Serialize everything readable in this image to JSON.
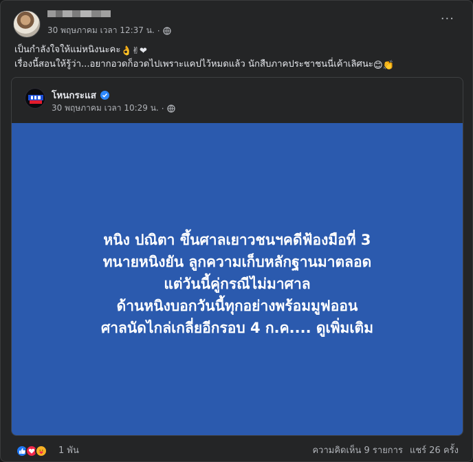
{
  "post": {
    "timestamp": "30 พฤษภาคม เวลา 12:37 น.",
    "separator": "·",
    "caption_line1": "เป็นกำลังใจให้แม่หนิงนะคะ",
    "caption_line1_emojis": "👌✌❤",
    "caption_line2": "เรื่องนี้สอนให้รู้ว่า...อยากอวดก็อวดไปเพราะแคปไว้หมดแล้ว นักสืบภาคประชาชนนี่เค้าเลิศนะ",
    "caption_line2_emojis": "😊👏",
    "more_label": "···"
  },
  "shared": {
    "page_name": "โหนกระแส",
    "timestamp": "30 พฤษภาคม เวลา 10:29 น.",
    "separator": "·",
    "card_lines": [
      "หนิง ปณิตา ขึ้นศาลเยาวชนฯคดีฟ้องมือที่ 3",
      "ทนายหนิงยัน ลูกความเก็บหลักฐานมาตลอด",
      "แต่วันนี้คู่กรณีไม่มาศาล",
      "ด้านหนิงบอกวันนี้ทุกอย่างพร้อมมูฟออน",
      "ศาลนัดไกล่เกลี่ยอีกรอบ 4 ก.ค.... ดูเพิ่มเติม"
    ],
    "card_color": "#2b5aae"
  },
  "footer": {
    "reaction_count": "1 พัน",
    "comments": "ความคิดเห็น 9 รายการ",
    "shares": "แชร์ 26 ครั้ง",
    "reaction_icons": [
      "like-icon",
      "love-icon",
      "care-icon"
    ]
  },
  "colors": {
    "background": "#242526",
    "text_primary": "#e4e6eb",
    "text_secondary": "#b0b3b8",
    "verified": "#2d88ff"
  }
}
